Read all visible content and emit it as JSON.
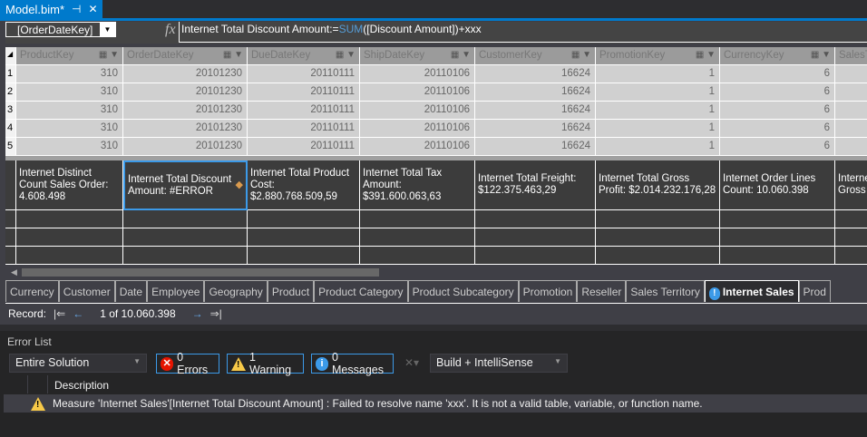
{
  "document_tab": {
    "title": "Model.bim*",
    "pin_icon": "pin-icon",
    "close_icon": "close-icon"
  },
  "formula_bar": {
    "column_selector": "[OrderDateKey]",
    "fx": "fx",
    "formula_prefix": "Internet Total Discount Amount:=",
    "formula_function": "SUM",
    "formula_suffix": "([Discount Amount])+xxx"
  },
  "grid": {
    "columns": [
      "ProductKey",
      "OrderDateKey",
      "DueDateKey",
      "ShipDateKey",
      "CustomerKey",
      "PromotionKey",
      "CurrencyKey",
      "SalesT"
    ],
    "rows": [
      {
        "num": "1",
        "cells": [
          "310",
          "20101230",
          "20110111",
          "20110106",
          "16624",
          "1",
          "6",
          ""
        ]
      },
      {
        "num": "2",
        "cells": [
          "310",
          "20101230",
          "20110111",
          "20110106",
          "16624",
          "1",
          "6",
          ""
        ]
      },
      {
        "num": "3",
        "cells": [
          "310",
          "20101230",
          "20110111",
          "20110106",
          "16624",
          "1",
          "6",
          ""
        ]
      },
      {
        "num": "4",
        "cells": [
          "310",
          "20101230",
          "20110111",
          "20110106",
          "16624",
          "1",
          "6",
          ""
        ]
      },
      {
        "num": "5",
        "cells": [
          "310",
          "20101230",
          "20110111",
          "20110106",
          "16624",
          "1",
          "6",
          ""
        ]
      }
    ]
  },
  "measures": [
    "Internet Distinct Count Sales Order: 4.608.498",
    "Internet Total Discount Amount: #ERROR",
    "Internet Total Product Cost: $2.880.768.509,59",
    "Internet Total Tax Amount: $391.600.063,63",
    "Internet Total Freight: $122.375.463,29",
    "Internet Total Gross Profit: $2.014.232.176,28",
    "Internet Order Lines Count: 10.060.398",
    "Internet Gross I"
  ],
  "sheet_tabs": [
    {
      "label": "Currency"
    },
    {
      "label": "Customer"
    },
    {
      "label": "Date"
    },
    {
      "label": "Employee"
    },
    {
      "label": "Geography"
    },
    {
      "label": "Product"
    },
    {
      "label": "Product Category"
    },
    {
      "label": "Product Subcategory"
    },
    {
      "label": "Promotion"
    },
    {
      "label": "Reseller"
    },
    {
      "label": "Sales Territory"
    },
    {
      "label": "Internet Sales",
      "active": true,
      "warning": true
    },
    {
      "label": "Prod"
    }
  ],
  "record_bar": {
    "label": "Record:",
    "position": "1 of 10.060.398"
  },
  "error_list": {
    "title": "Error List",
    "scope": "Entire Solution",
    "errors": "0 Errors",
    "warnings": "1 Warning",
    "messages": "0 Messages",
    "source": "Build + IntelliSense",
    "description_header": "Description",
    "items": [
      {
        "severity": "warning",
        "description": "Measure 'Internet Sales'[Internet Total Discount Amount] : Failed to resolve name 'xxx'. It is not a valid table, variable, or function name."
      }
    ]
  },
  "colors": {
    "accent": "#007acc",
    "selection": "#3c9ae8",
    "warning": "#f7c948",
    "error": "#e51400"
  }
}
